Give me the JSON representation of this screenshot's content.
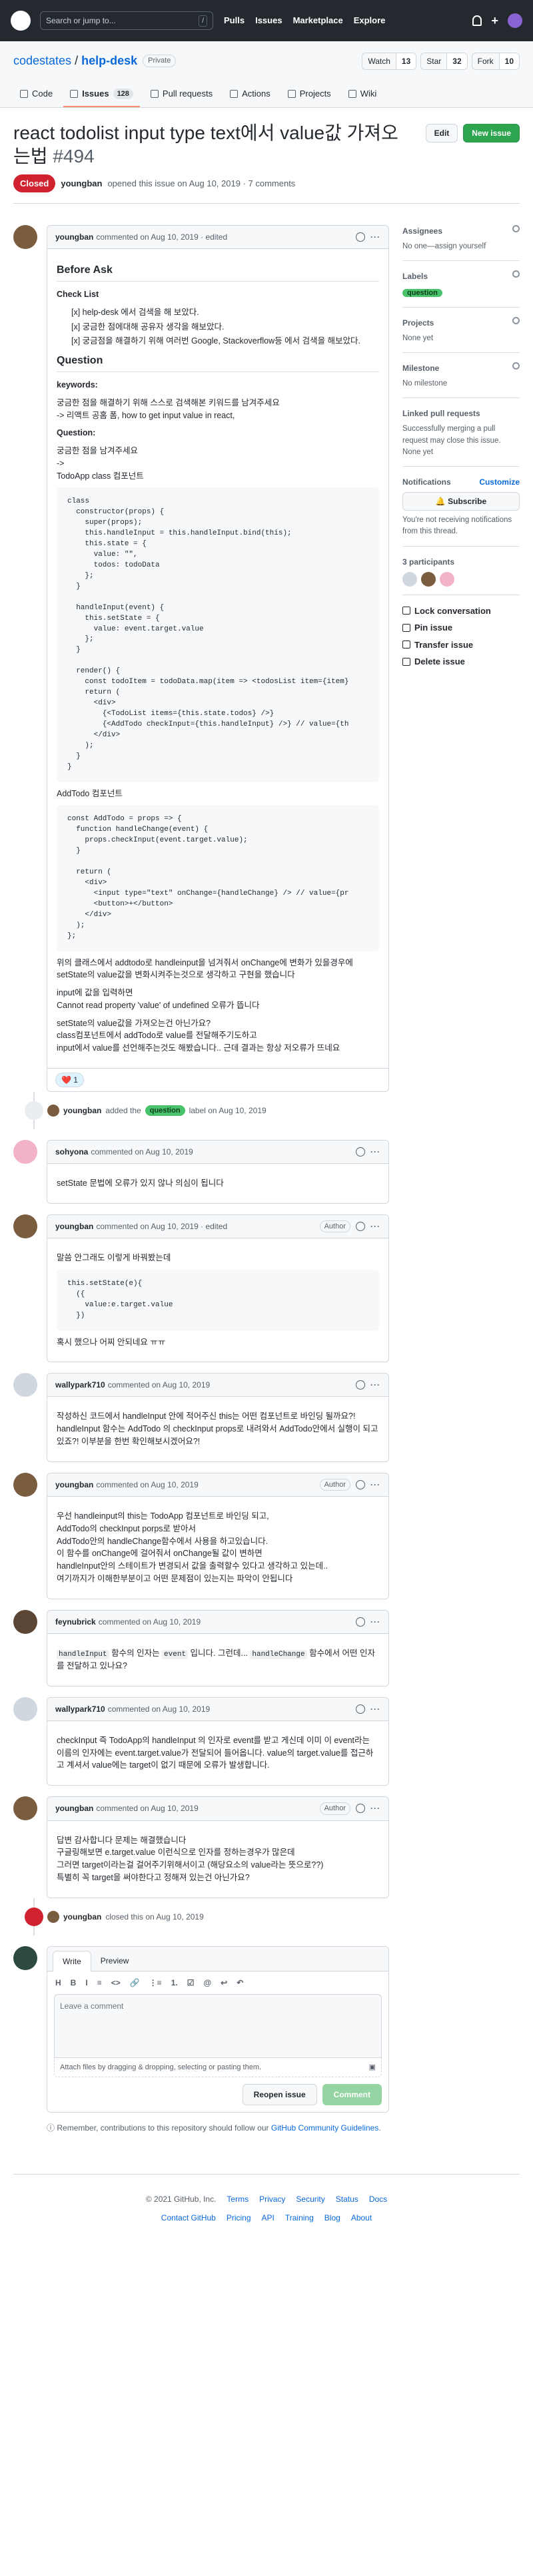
{
  "header": {
    "search_placeholder": "Search or jump to...",
    "search_key": "/",
    "nav": [
      "Pulls",
      "Issues",
      "Marketplace",
      "Explore"
    ],
    "plus": "+"
  },
  "repo": {
    "owner": "codestates",
    "separator": " / ",
    "name": "help-desk",
    "visibility": "Private",
    "watch_label": "Watch",
    "watch_count": "13",
    "star_label": "Star",
    "star_count": "32",
    "fork_label": "Fork",
    "fork_count": "10"
  },
  "tabs": [
    {
      "label": "Code"
    },
    {
      "label": "Issues",
      "count": "128"
    },
    {
      "label": "Pull requests"
    },
    {
      "label": "Actions"
    },
    {
      "label": "Projects"
    },
    {
      "label": "Wiki"
    }
  ],
  "issue": {
    "title": "react todolist input type text에서 value값 가져오는법",
    "number": "#494",
    "edit_label": "Edit",
    "new_label": "New issue",
    "state": "Closed",
    "author": "youngban",
    "opened_text": "opened this issue on Aug 10, 2019 · 7 comments"
  },
  "colors": {
    "closed": "#cf222e",
    "green": "#2da44e",
    "label_question": "#4ac26b"
  },
  "comment1": {
    "author": "youngban",
    "meta": "commented on Aug 10, 2019 · edited",
    "h_before": "Before Ask",
    "checklist_title": "Check List",
    "checklist": [
      "[x] help-desk 에서 검색을 해 보았다.",
      "[x] 궁금한 점에대해 공유자 생각을 해보았다.",
      "[x] 궁금점을 해결하기 위해 여러번 Google, Stackoverflow등 에서 검색을 해보았다."
    ],
    "h_question": "Question",
    "kw_title": "keywords:",
    "kw1": "궁금한 점을 해결하기 위해 스스로 검색해본 키워드를 남겨주세요",
    "kw2": "-> 리액트 공홈 폼, how to get input value in react,",
    "q_title": "Question:",
    "q1": "궁금한 점을 남겨주세요",
    "q2": "->",
    "q3": "TodoApp class 컴포넌트",
    "code1": "class\n  constructor(props) {\n    super(props);\n    this.handleInput = this.handleInput.bind(this);\n    this.state = {\n      value: \"\",\n      todos: todoData\n    };\n  }\n\n  handleInput(event) {\n    this.setState = {\n      value: event.target.value\n    };\n  }\n\n  render() {\n    const todoItem = todoData.map(item => <todosList item={item}\n    return (\n      <div>\n        {<TodoList items={this.state.todos} />}\n        {<AddTodo checkInput={this.handleInput} />} // value={th\n      </div>\n    );\n  }\n}",
    "addtodo_title": "AddTodo 컴포넌트",
    "code2": "const AddTodo = props => {\n  function handleChange(event) {\n    props.checkInput(event.target.value);\n  }\n\n  return (\n    <div>\n      <input type=\"text\" onChange={handleChange} /> // value={pr\n      <button>+</button>\n    </div>\n  );\n};",
    "p1": "위의 클래스에서 addtodo로 handleinput을 넘겨줘서 onChange에 변화가 있을경우에 setState의 value값을 변화시켜주는것으로 생각하고 구현을 했습니다",
    "p2a": "input에 값을 입력하면",
    "p2b": "Cannot read property 'value' of undefined 오류가 뜹니다",
    "p3a": "setState의 value값을 가져오는건 아닌가요?",
    "p3b": "class컴포넌트에서 addTodo로 value를 전달해주기도하고",
    "p3c": "input에서 value를 선언해주는것도 해봤습니다.. 근데 결과는 항상 저오류가 뜨네요",
    "reaction": "❤️ 1"
  },
  "event1": {
    "actor": "youngban",
    "pre": "added the",
    "label": "question",
    "post": "label on Aug 10, 2019"
  },
  "comment2": {
    "author": "sohyona",
    "meta": "commented on Aug 10, 2019",
    "body": "setState 문법에 오류가 있지 않나 의심이 됩니다"
  },
  "comment3": {
    "author": "youngban",
    "meta": "commented on Aug 10, 2019 · edited",
    "badge": "Author",
    "body1": "말씀 안그래도 이렇게 바꿔봤는데",
    "code": "this.setState(e){\n  ({\n    value:e.target.value\n  })",
    "body2": "혹시 했으나 어찌 안되네요 ㅠㅠ"
  },
  "comment4": {
    "author": "wallypark710",
    "meta": "commented on Aug 10, 2019",
    "body": "작성하신 코드에서 handleInput 안에 적어주신 this는 어떤 컴포넌트로 바인딩 될까요?! handleInput 함수는 AddTodo 의 checkInput props로 내려와서 AddTodo안에서 실행이 되고있죠?! 이부분을 한번 확인해보시겠어요?!"
  },
  "comment5": {
    "author": "youngban",
    "meta": "commented on Aug 10, 2019",
    "badge": "Author",
    "lines": [
      "우선 handleinput의 this는 TodoApp 컴포넌트로 바인딩 되고,",
      "AddTodo의 checkInput porps로 받아서",
      "AddTodo안의 handleChange함수에서 사용을 하고있습니다.",
      "이 함수를 onChange에 걸어줘서 onChange될 값이 변하면",
      "handleInput안의 스테이트가 변경되서 값을 출력할수 있다고 생각하고 있는데..",
      "여기까지가 이해한부분이고 어떤 문제점이 있는지는 파악이 안됩니다"
    ]
  },
  "comment6": {
    "author": "feynubrick",
    "meta": "commented on Aug 10, 2019",
    "code1": "handleInput",
    "t1": " 함수의 인자는 ",
    "code2": "event",
    "t2": " 입니다. 그런데... ",
    "code3": "handleChange",
    "t3": " 함수에서 어떤 인자를 전달하고 있나요?"
  },
  "comment7": {
    "author": "wallypark710",
    "meta": "commented on Aug 10, 2019",
    "body": "checkInput 즉 TodoApp의 handleInput 의 인자로 event를 받고 게신데 이미 이 event라는 이름의 인자에는 event.target.value가 전달되어 들어옵니다. value의 target.value를 접근하고 계셔서 value에는 target이 없기 때문에 오류가 발생합니다."
  },
  "comment8": {
    "author": "youngban",
    "meta": "commented on Aug 10, 2019",
    "badge": "Author",
    "lines": [
      "답변 감사합니다 문제는 해결했습니다",
      "구글링해보면 e.target.value 이런식으로 인자를 정하는경우가 많은데",
      "그러면 target이라는걸 걸어주기위해서이고 (해당요소의 value라는 뜻으로??)",
      "특별히 꼭 target을 써야한다고 정해져 있는건 아닌가요?"
    ]
  },
  "event2": {
    "actor": "youngban",
    "text": "closed this on Aug 10, 2019"
  },
  "editor": {
    "tab_write": "Write",
    "tab_preview": "Preview",
    "tools": [
      "H",
      "B",
      "I",
      "≡",
      "<>",
      "🔗",
      "⋮≡",
      "1.",
      "☑",
      "@",
      "↩",
      "↶"
    ],
    "placeholder": "Leave a comment",
    "attach": "Attach files by dragging & dropping, selecting or pasting them.",
    "reopen": "Reopen issue",
    "comment": "Comment",
    "remember_pre": "Remember, contributions to this repository should follow our",
    "remember_link": "GitHub Community Guidelines",
    "remember_post": "."
  },
  "sidebar": {
    "assignees_h": "Assignees",
    "assignees_v": "No one—assign yourself",
    "labels_h": "Labels",
    "label": "question",
    "projects_h": "Projects",
    "projects_v": "None yet",
    "milestone_h": "Milestone",
    "milestone_v": "No milestone",
    "linked_h": "Linked pull requests",
    "linked_v": "Successfully merging a pull request may close this issue.",
    "linked_v2": "None yet",
    "notif_h": "Notifications",
    "notif_cust": "Customize",
    "subscribe": "Subscribe",
    "notif_v": "You're not receiving notifications from this thread.",
    "participants_h": "3 participants",
    "actions": [
      "Lock conversation",
      "Pin issue",
      "Transfer issue",
      "Delete issue"
    ]
  },
  "footer": {
    "row1": [
      "© 2021 GitHub, Inc.",
      "Terms",
      "Privacy",
      "Security",
      "Status",
      "Docs"
    ],
    "row2": [
      "Contact GitHub",
      "Pricing",
      "API",
      "Training",
      "Blog",
      "About"
    ]
  }
}
